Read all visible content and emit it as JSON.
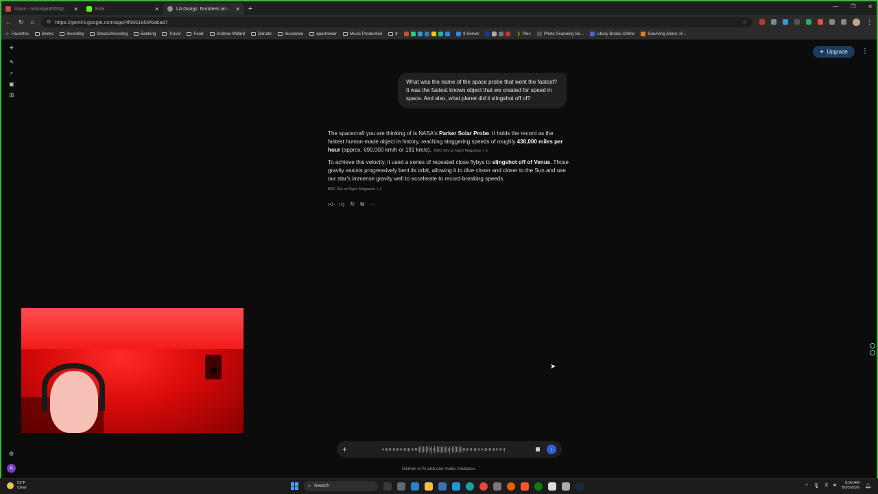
{
  "browser": {
    "tabs": [
      {
        "title": "Inbox - nobodylol520@gmail.com",
        "active": false,
        "color": "#d14836"
      },
      {
        "title": "Kick",
        "active": false,
        "color": "#53fc18"
      },
      {
        "title": "LA Gangs: Numbers and Chu",
        "active": true,
        "color": "#8e8e8e"
      }
    ],
    "url": "https://gemini.google.com/app/4f6651856f6abad7",
    "bookmarks": [
      "Favorites",
      "Books",
      "Investing",
      "Stocks/Investing",
      "Banking",
      "Travel",
      "Food",
      "Andrew Willard",
      "Donate",
      "Insurance",
      "quarrtower",
      "Music Production",
      "tr",
      "8 Server",
      "Plex",
      "Photo Scanning Se...",
      "Libary Books Online",
      "Surviving Alone: H..."
    ]
  },
  "gemini": {
    "upgrade_label": "Upgrade",
    "user_message": "What was the name of the space probe that went the fastest? It was the fastest known object that we created for speed in space. And also, what planet did it slingshot off of?",
    "response": {
      "p1_a": "The spacecraft you are thinking of is NASA's ",
      "p1_b": "Parker Solar Probe",
      "p1_c": ". It holds the record as the fastest human-made object in history, reaching staggering speeds of roughly ",
      "p1_d": "430,000 miles per hour",
      "p1_e": " (approx. 690,000 km/h or 191 km/s).",
      "p1_src": "BBC Sky at Night Magazine + 1",
      "p2_a": "To achieve this velocity, it used a series of repeated close flybys to ",
      "p2_b": "slingshot off of Venus",
      "p2_c": ". Those gravity assists progressively bent its orbit, allowing it to dive closer and closer to the Sun and use our star's immense gravity well to accelerate to record-breaking speeds.",
      "p2_src": "BBC Sky at Night Magazine + 1"
    },
    "account_initial": "A",
    "disclaimer": "Gemini is AI and can make mistakes."
  },
  "taskbar": {
    "weather_temp": "53°F",
    "weather_desc": "Clear",
    "search_label": "Search",
    "time": "5:58 AM",
    "date": "8/20/2026"
  },
  "colors": {
    "accent": "#2f5fd8",
    "upgrade_bg": "#1d3b5c",
    "webcam_red": "#e01010"
  }
}
